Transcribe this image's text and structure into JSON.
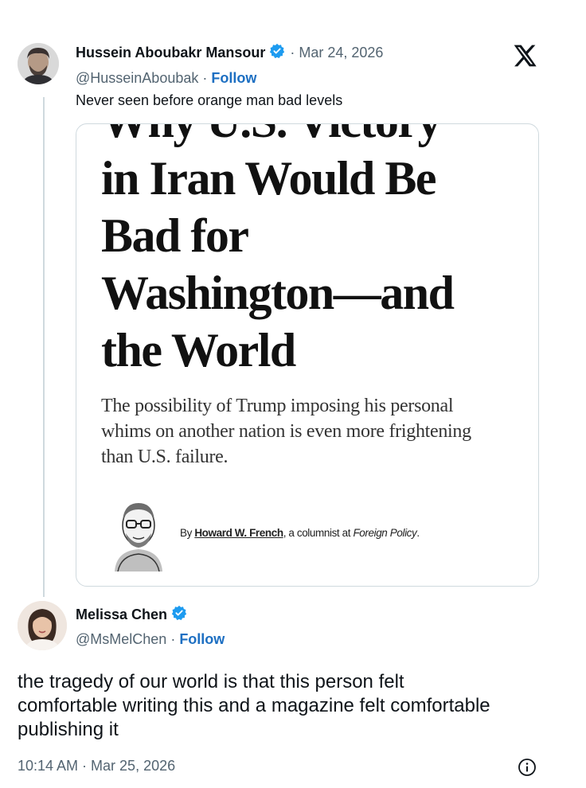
{
  "tweet": {
    "author_name": "Hussein Aboubakr Mansour",
    "date": "· Mar 24, 2026",
    "handle": "@HusseinAboubak",
    "separator": "·",
    "follow_label": "Follow",
    "text": "Never seen before orange man bad levels",
    "article": {
      "headline_lines": [
        "Why U.S. Victory",
        "in Iran Would Be",
        "Bad for",
        "Washington—and",
        "the World"
      ],
      "dek": "The possibility of Trump imposing his personal whims on another nation is even more frightening than U.S. failure.",
      "byline_prefix": "By ",
      "byline_author": "Howard W. French",
      "byline_middle": ", a columnist at ",
      "byline_publication": "Foreign Policy",
      "byline_end": "."
    }
  },
  "reply": {
    "author_name": "Melissa Chen",
    "handle": "@MsMelChen",
    "separator": "·",
    "follow_label": "Follow",
    "text": "the tragedy of our world is that this person felt comfortable writing this and a magazine felt comfortable publishing it",
    "timestamp": "10:14 AM · Mar 25, 2026"
  },
  "icons": {
    "platform_logo": "x-logo-icon",
    "verified": "verified-badge-icon",
    "info": "info-icon"
  },
  "colors": {
    "follow_blue": "#1d6fc2",
    "verified_blue": "#1d9bf0",
    "muted_text": "#536471"
  }
}
